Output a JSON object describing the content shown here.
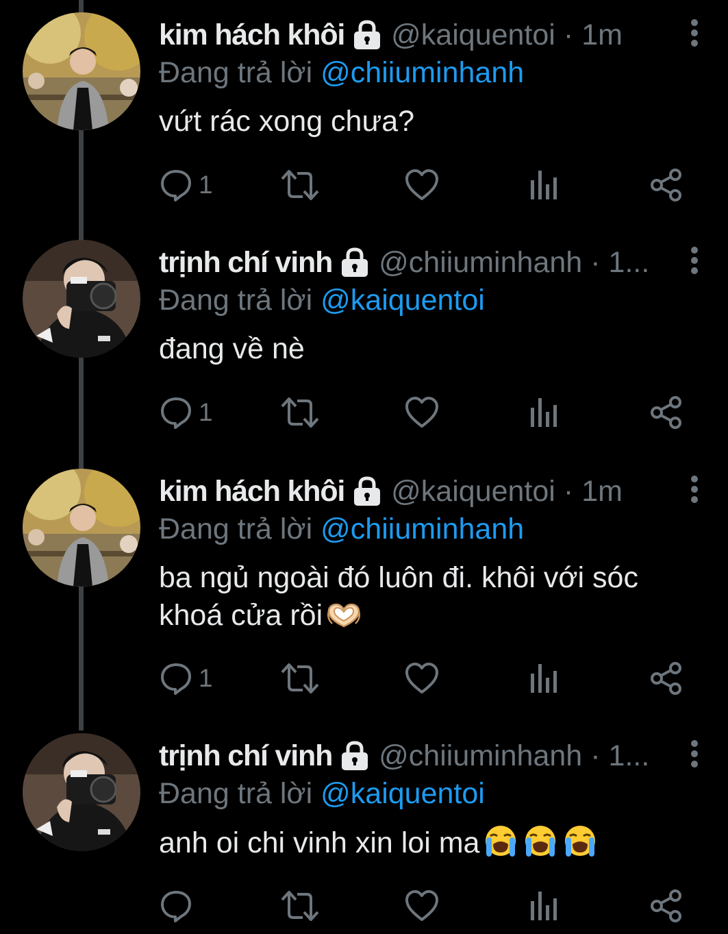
{
  "tweets": [
    {
      "display_name": "kim hách khôi",
      "handle": "@kaiquentoi",
      "separator": "·",
      "time": "1m",
      "reply_prefix": "Đang trả lời",
      "reply_to": "@chiiuminhanh",
      "text": "vứt rác xong chưa?",
      "reply_count": "1",
      "avatar": "avatar-khoi",
      "emojis": []
    },
    {
      "display_name": "trịnh chí vinh",
      "handle": "@chiiuminhanh",
      "separator": "·",
      "time": "1...",
      "reply_prefix": "Đang trả lời",
      "reply_to": "@kaiquentoi",
      "text": "đang về nè",
      "reply_count": "1",
      "avatar": "avatar-vinh",
      "emojis": []
    },
    {
      "display_name": "kim hách khôi",
      "handle": "@kaiquentoi",
      "separator": "·",
      "time": "1m",
      "reply_prefix": "Đang trả lời",
      "reply_to": "@chiiuminhanh",
      "text": "ba ngủ ngoài đó luôn đi. khôi với sóc khoá cửa rồi",
      "reply_count": "1",
      "avatar": "avatar-khoi",
      "emojis": [
        "heart-hands-emoji"
      ]
    },
    {
      "display_name": "trịnh chí vinh",
      "handle": "@chiiuminhanh",
      "separator": "·",
      "time": "1...",
      "reply_prefix": "Đang trả lời",
      "reply_to": "@kaiquentoi",
      "text": "anh oi chi vinh xin loi ma",
      "reply_count": "",
      "avatar": "avatar-vinh",
      "emojis": [
        "loudly-crying-face-emoji",
        "loudly-crying-face-emoji",
        "loudly-crying-face-emoji"
      ]
    }
  ],
  "icons": {
    "lock": "lock-icon",
    "more": "more-vertical-icon",
    "reply": "reply-icon",
    "retweet": "retweet-icon",
    "like": "heart-icon",
    "views": "analytics-icon",
    "share": "share-icon"
  },
  "colors": {
    "background": "#000000",
    "text": "#e7e9ea",
    "muted": "#6e767d",
    "link": "#1d9bf0",
    "thread_line": "#3e4144"
  }
}
